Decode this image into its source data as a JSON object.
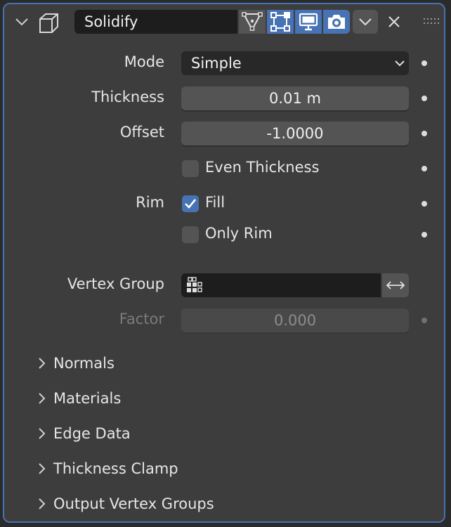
{
  "header": {
    "modifier_name": "Solidify",
    "icons": [
      "chevron-down-icon",
      "solidify-modifier-icon",
      "edit-cage-icon",
      "edit-mode-icon",
      "viewport-icon",
      "render-camera-icon",
      "dropdown-chevron-icon",
      "close-icon",
      "drag-handle-icon"
    ]
  },
  "fields": {
    "mode": {
      "label": "Mode",
      "value": "Simple"
    },
    "thickness": {
      "label": "Thickness",
      "value": "0.01 m"
    },
    "offset": {
      "label": "Offset",
      "value": "-1.0000"
    },
    "even_thickness": {
      "label": "Even Thickness",
      "checked": false
    },
    "rim": {
      "label": "Rim"
    },
    "fill": {
      "label": "Fill",
      "checked": true
    },
    "only_rim": {
      "label": "Only Rim",
      "checked": false
    },
    "vertex_group": {
      "label": "Vertex Group",
      "value": ""
    },
    "factor": {
      "label": "Factor",
      "value": "0.000"
    }
  },
  "subpanels": [
    "Normals",
    "Materials",
    "Edge Data",
    "Thickness Clamp",
    "Output Vertex Groups"
  ],
  "colors": {
    "accent": "#4772b3",
    "panel_bg": "#3d3d3d",
    "field_bg": "#545454"
  }
}
